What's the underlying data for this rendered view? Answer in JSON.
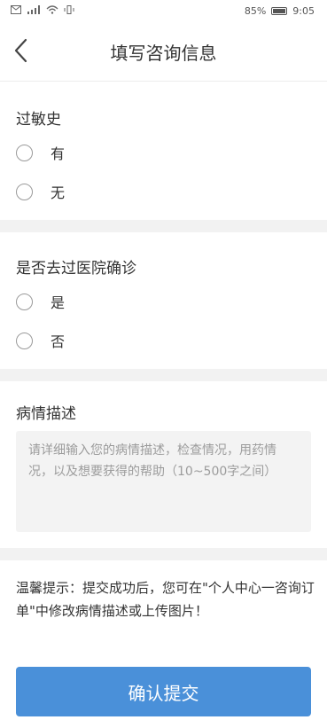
{
  "status_bar": {
    "battery_percent": "85%",
    "time": "9:05"
  },
  "nav": {
    "title": "填写咨询信息",
    "back_icon": "chevron-left-icon"
  },
  "allergy": {
    "title": "过敏史",
    "options": [
      "有",
      "无"
    ]
  },
  "hospital": {
    "title": "是否去过医院确诊",
    "options": [
      "是",
      "否"
    ]
  },
  "description": {
    "title": "病情描述",
    "placeholder": "请详细输入您的病情描述，检查情况，用药情况，以及想要获得的帮助（10~500字之间）"
  },
  "tip": {
    "text": "温馨提示：提交成功后，您可在\"个人中心一咨询订单\"中修改病情描述或上传图片！"
  },
  "submit": {
    "label": "确认提交"
  },
  "colors": {
    "primary": "#4a90d9",
    "separator": "#f2f2f2",
    "textarea_bg": "#f3f3f3"
  }
}
